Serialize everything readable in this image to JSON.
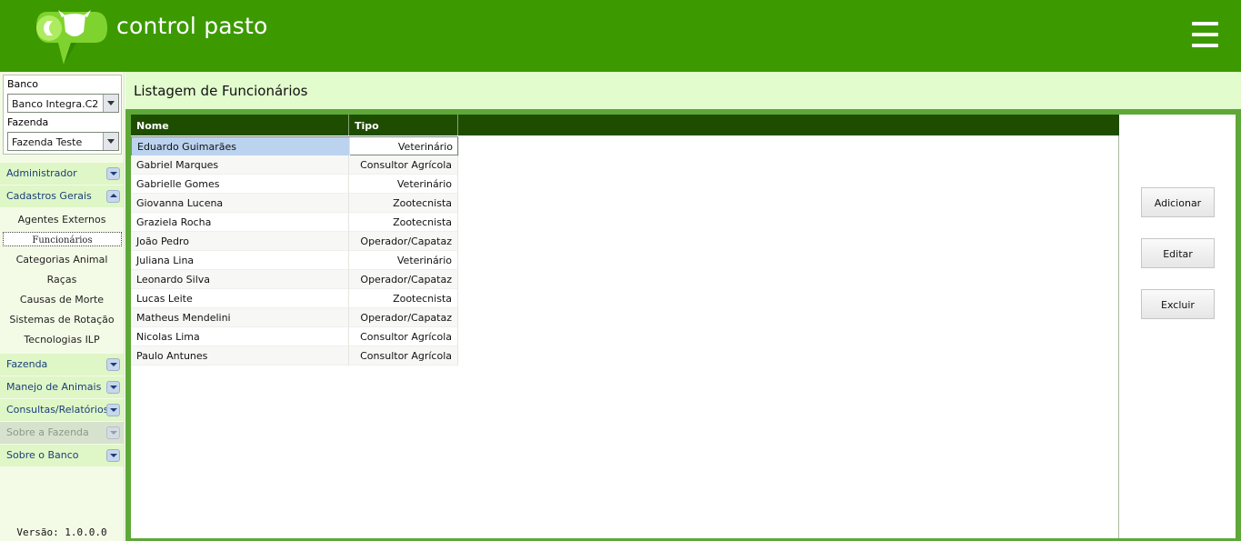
{
  "header": {
    "brand": "control pasto",
    "menu_icon": "hamburger-menu-icon"
  },
  "sidebar": {
    "banco_label": "Banco",
    "banco_value": "Banco Integra.C2",
    "fazenda_label": "Fazenda",
    "fazenda_value": "Fazenda Teste",
    "sections": {
      "administrador": "Administrador",
      "cadastros_gerais": "Cadastros Gerais",
      "fazenda": "Fazenda",
      "manejo": "Manejo de Animais",
      "consultas": "Consultas/Relatórios",
      "sobre_fazenda": "Sobre a Fazenda",
      "sobre_banco": "Sobre o Banco"
    },
    "cadastros_items": [
      "Agentes Externos",
      "Funcionários",
      "Categorias Animal",
      "Raças",
      "Causas de Morte",
      "Sistemas de Rotação",
      "Tecnologias ILP"
    ],
    "version": "Versão: 1.0.0.0"
  },
  "main": {
    "title": "Listagem de Funcionários",
    "columns": [
      "Nome",
      "Tipo"
    ],
    "rows": [
      {
        "nome": "Eduardo Guimarães",
        "tipo": "Veterinário"
      },
      {
        "nome": "Gabriel Marques",
        "tipo": "Consultor Agrícola"
      },
      {
        "nome": "Gabrielle Gomes",
        "tipo": "Veterinário"
      },
      {
        "nome": "Giovanna Lucena",
        "tipo": "Zootecnista"
      },
      {
        "nome": "Graziela Rocha",
        "tipo": "Zootecnista"
      },
      {
        "nome": "João Pedro",
        "tipo": "Operador/Capataz"
      },
      {
        "nome": "Juliana Lina",
        "tipo": "Veterinário"
      },
      {
        "nome": "Leonardo Silva",
        "tipo": "Operador/Capataz"
      },
      {
        "nome": "Lucas Leite",
        "tipo": "Zootecnista"
      },
      {
        "nome": "Matheus Mendelini",
        "tipo": "Operador/Capataz"
      },
      {
        "nome": "Nicolas Lima",
        "tipo": "Consultor Agrícola"
      },
      {
        "nome": "Paulo Antunes",
        "tipo": "Consultor Agrícola"
      }
    ],
    "buttons": {
      "add": "Adicionar",
      "edit": "Editar",
      "delete": "Excluir"
    }
  },
  "colors": {
    "header": "#3c9a00",
    "title_bar": "#e2fccd",
    "grid_header": "#1f4d00",
    "selected_row": "#bcd3f0",
    "menu_head": "#dff6c7"
  }
}
